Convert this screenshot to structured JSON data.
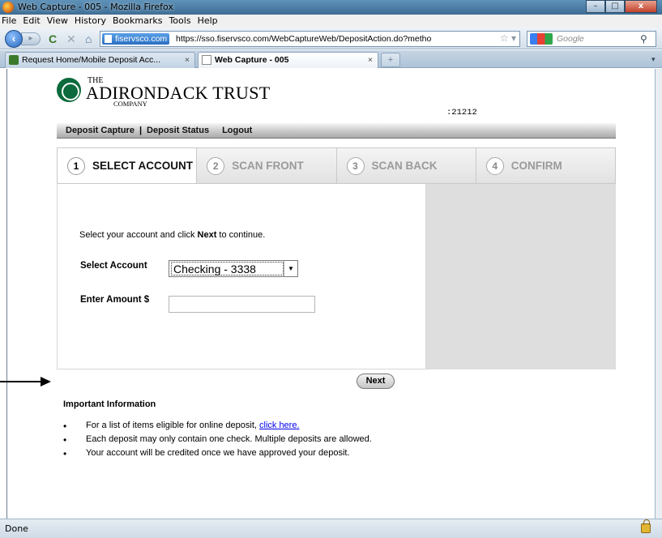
{
  "window": {
    "title": "Web Capture - 005 - Mozilla Firefox",
    "controls": {
      "minimize": "–",
      "maximize": "□",
      "close": "x"
    }
  },
  "menu": [
    "File",
    "Edit",
    "View",
    "History",
    "Bookmarks",
    "Tools",
    "Help"
  ],
  "nav": {
    "site_badge": "fiservsco.com",
    "url": "https://sso.fiservsco.com/WebCaptureWeb/DepositAction.do?metho",
    "search_placeholder": "Google",
    "icons": {
      "back": "back-arrow-icon",
      "forward": "forward-arrow-icon",
      "reload": "reload-icon",
      "stop": "stop-icon",
      "home": "home-icon",
      "star": "bookmark-star-icon",
      "search": "magnifier-icon"
    }
  },
  "tabs": [
    {
      "label": "Request Home/Mobile Deposit Acc...",
      "active": false
    },
    {
      "label": "Web Capture - 005",
      "active": true
    }
  ],
  "tab_close": "×",
  "tab_new": "+",
  "bank": {
    "the": "THE",
    "name": "ADIRONDACK TRUST",
    "company": "COMPANY",
    "account_id": ":21212"
  },
  "appnav": {
    "deposit_capture": "Deposit Capture",
    "separator": "|",
    "deposit_status": "Deposit Status",
    "logout": "Logout"
  },
  "steps": [
    {
      "num": "1",
      "label": "SELECT ACCOUNT",
      "active": true
    },
    {
      "num": "2",
      "label": "SCAN FRONT",
      "active": false
    },
    {
      "num": "3",
      "label": "SCAN BACK",
      "active": false
    },
    {
      "num": "4",
      "label": "CONFIRM",
      "active": false
    }
  ],
  "form": {
    "instruction_pre": "Select your account and click ",
    "instruction_bold": "Next",
    "instruction_post": " to continue.",
    "account_label": "Select Account",
    "account_value": "Checking - 3338",
    "amount_label": "Enter Amount $",
    "amount_value": ""
  },
  "next_button": "Next",
  "info": {
    "title": "Important Information",
    "bullet": "•",
    "item1_text": "For a list of items eligible for online deposit, ",
    "item1_link": "click here.",
    "item2": "Each deposit may only contain one check. Multiple deposits are allowed.",
    "item3": "Your account will be credited once we have approved your deposit."
  },
  "status": {
    "text": "Done",
    "icon": "padlock-icon"
  }
}
